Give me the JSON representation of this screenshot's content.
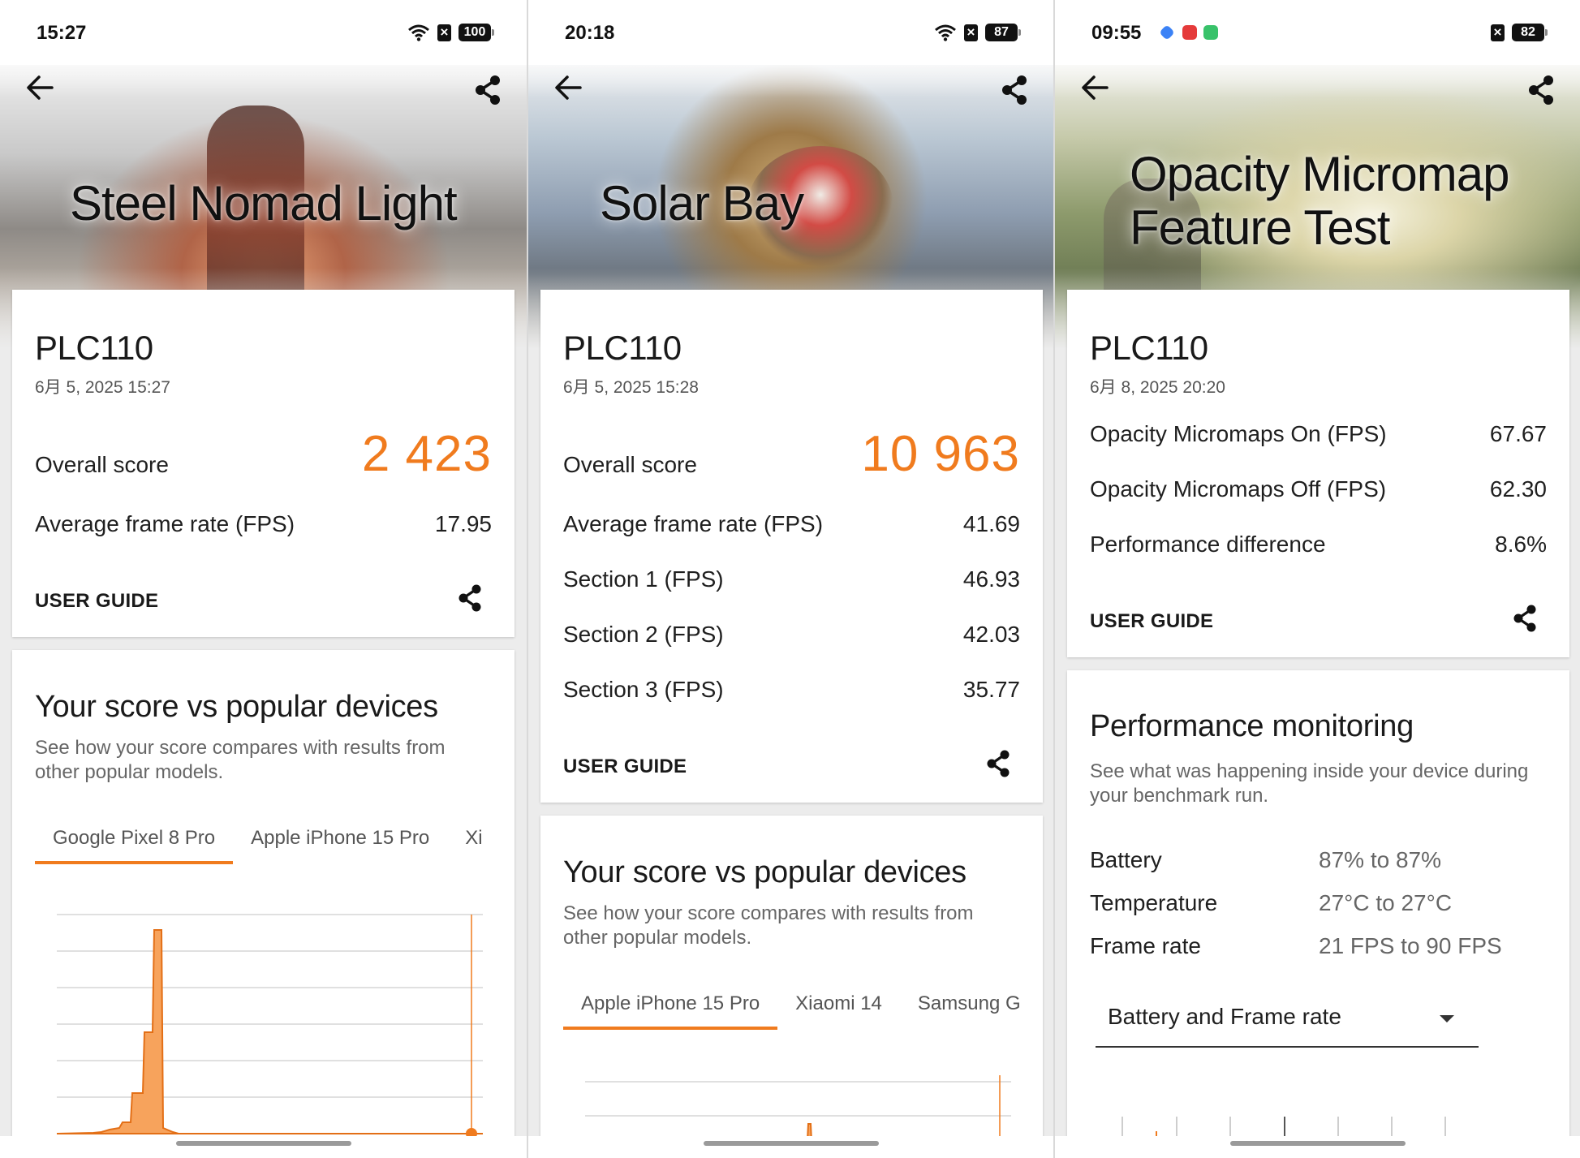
{
  "screens": [
    {
      "status": {
        "time": "15:27",
        "battery": "100"
      },
      "hero_title": "Steel Nomad Light",
      "device": "PLC110",
      "date": "6月 5, 2025 15:27",
      "overall_label": "Overall score",
      "overall_score": "2 423",
      "rows": [
        {
          "label": "Average frame rate (FPS)",
          "value": "17.95"
        }
      ],
      "user_guide": "USER GUIDE",
      "compare": {
        "title": "Your score vs popular devices",
        "subtitle": "See how your score compares with results from other popular models.",
        "tabs": [
          "Google Pixel 8 Pro",
          "Apple iPhone 15 Pro",
          "Xi"
        ]
      }
    },
    {
      "status": {
        "time": "20:18",
        "battery": "87"
      },
      "hero_title": "Solar Bay",
      "device": "PLC110",
      "date": "6月 5, 2025 15:28",
      "overall_label": "Overall score",
      "overall_score": "10 963",
      "rows": [
        {
          "label": "Average frame rate (FPS)",
          "value": "41.69"
        },
        {
          "label": "Section 1 (FPS)",
          "value": "46.93"
        },
        {
          "label": "Section 2 (FPS)",
          "value": "42.03"
        },
        {
          "label": "Section 3 (FPS)",
          "value": "35.77"
        }
      ],
      "user_guide": "USER GUIDE",
      "compare": {
        "title": "Your score vs popular devices",
        "subtitle": "See how your score compares with results from other popular models.",
        "tabs": [
          "Apple iPhone 15 Pro",
          "Xiaomi 14",
          "Samsung G"
        ]
      }
    },
    {
      "status": {
        "time": "09:55",
        "battery": "82"
      },
      "hero_title_lines": [
        "Opacity Micromap",
        "Feature Test"
      ],
      "device": "PLC110",
      "date": "6月 8, 2025 20:20",
      "rows": [
        {
          "label": "Opacity Micromaps On (FPS)",
          "value": "67.67"
        },
        {
          "label": "Opacity Micromaps Off (FPS)",
          "value": "62.30"
        },
        {
          "label": "Performance difference",
          "value": "8.6%"
        }
      ],
      "user_guide": "USER GUIDE",
      "monitoring": {
        "title": "Performance monitoring",
        "subtitle": "See what was happening inside your device during your benchmark run.",
        "rows": [
          {
            "label": "Battery",
            "value": "87% to 87%"
          },
          {
            "label": "Temperature",
            "value": "27°C to 27°C"
          },
          {
            "label": "Frame rate",
            "value": "21 FPS to 90 FPS"
          }
        ],
        "dropdown": "Battery and Frame rate"
      }
    }
  ],
  "colors": {
    "accent": "#f07b1e",
    "histogram_fill": "#f7a35c"
  },
  "icons": [
    "back-arrow-icon",
    "share-icon",
    "wifi-icon",
    "sim-off-icon",
    "battery-icon",
    "chevron-down-icon"
  ]
}
